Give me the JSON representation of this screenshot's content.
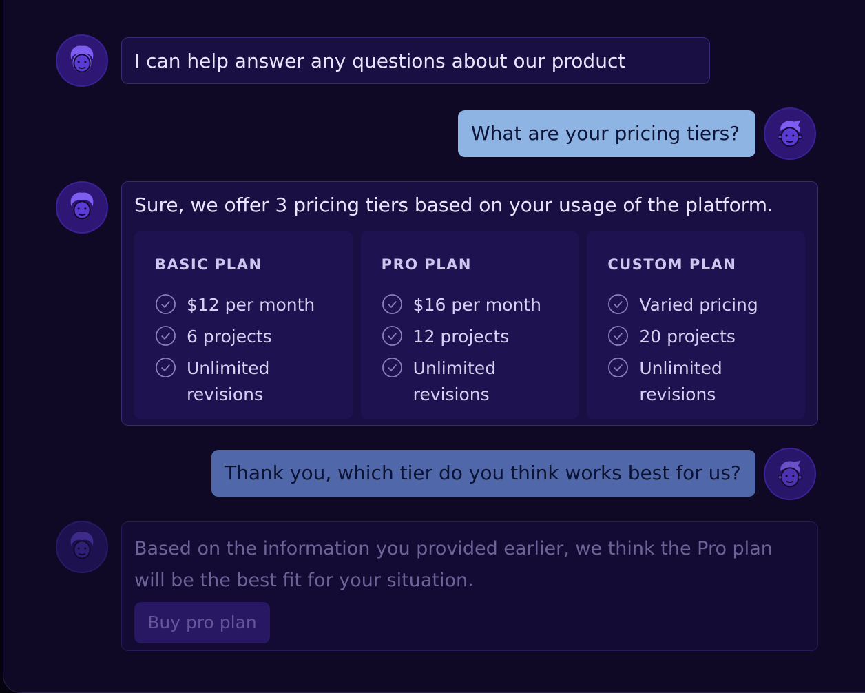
{
  "messages": {
    "bot_intro": "I can help answer any questions about our product",
    "user_question": "What are your pricing tiers?",
    "bot_pricing": "Sure, we offer 3 pricing tiers based on your usage of the platform.",
    "user_followup": "Thank you, which tier do you think works best for us?",
    "bot_recommend": "Based on the information you provided earlier, we think the Pro plan will be the best fit for your situation."
  },
  "plans": [
    {
      "name": "BASIC PLAN",
      "features": [
        "$12 per month",
        "6 projects",
        "Unlimited revisions"
      ]
    },
    {
      "name": "PRO PLAN",
      "features": [
        "$16 per month",
        "12 projects",
        "Unlimited revisions"
      ]
    },
    {
      "name": "CUSTOM PLAN",
      "features": [
        "Varied pricing",
        "20 projects",
        "Unlimited revisions"
      ]
    }
  ],
  "buy_button_label": "Buy pro plan",
  "icons": {
    "bot_avatar": "bot-avatar-icon",
    "user_avatar": "user-avatar-icon",
    "check": "check-circle-icon"
  },
  "colors": {
    "background": "#0f0926",
    "bot_bubble": "#1a0f42",
    "user_bubble_light": "#8db4e3",
    "user_bubble_muted": "#5068a9",
    "avatar": "#2e1774",
    "plan_card": "#1f1250"
  }
}
